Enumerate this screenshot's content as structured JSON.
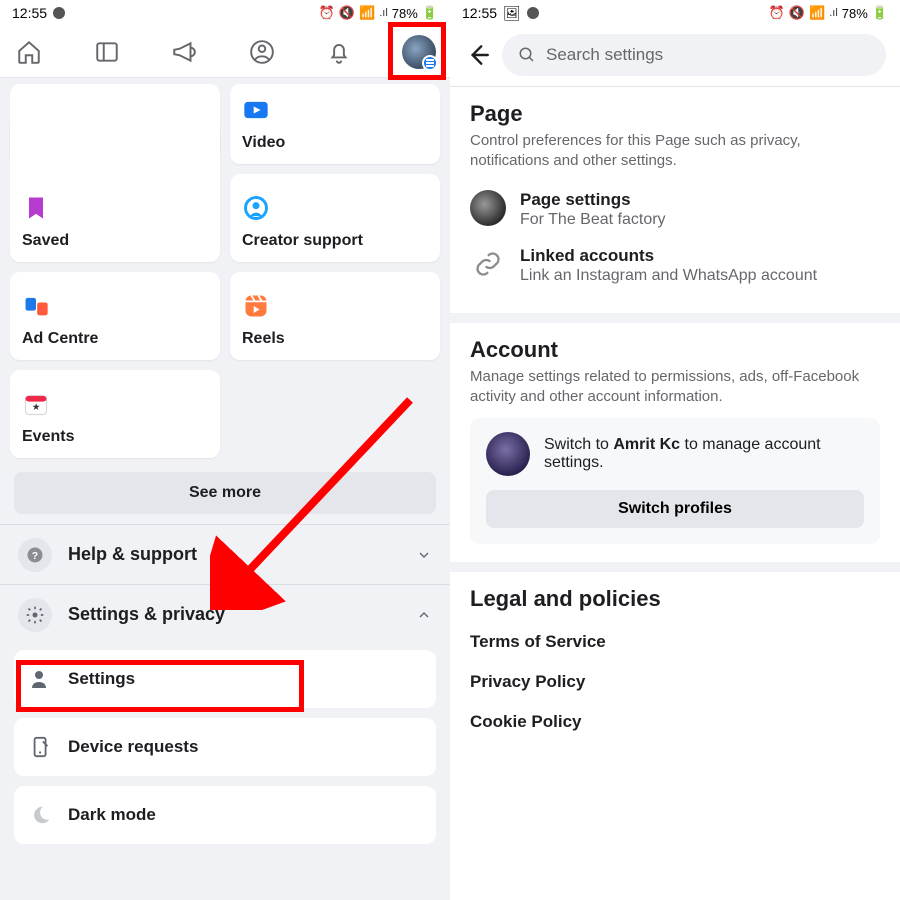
{
  "status": {
    "time": "12:55",
    "battery": "78%"
  },
  "left": {
    "grid": {
      "saved": "Saved",
      "video": "Video",
      "ad_centre": "Ad Centre",
      "creator_support": "Creator support",
      "events": "Events",
      "reels": "Reels"
    },
    "see_more": "See more",
    "help_support": "Help & support",
    "settings_privacy": "Settings & privacy",
    "sub": {
      "settings": "Settings",
      "device_requests": "Device requests",
      "dark_mode": "Dark mode"
    }
  },
  "right": {
    "search_placeholder": "Search settings",
    "page": {
      "title": "Page",
      "desc": "Control preferences for this Page such as privacy, notifications and other settings.",
      "page_settings": {
        "title": "Page settings",
        "sub": "For The Beat factory"
      },
      "linked": {
        "title": "Linked accounts",
        "sub": "Link an Instagram and WhatsApp account"
      }
    },
    "account": {
      "title": "Account",
      "desc": "Manage settings related to permissions, ads, off-Facebook activity and other account information.",
      "switch_pre": "Switch to ",
      "switch_name": "Amrit Kc",
      "switch_post": " to manage account settings.",
      "switch_btn": "Switch profiles"
    },
    "legal": {
      "title": "Legal and policies",
      "items": [
        "Terms of Service",
        "Privacy Policy",
        "Cookie Policy"
      ]
    }
  }
}
